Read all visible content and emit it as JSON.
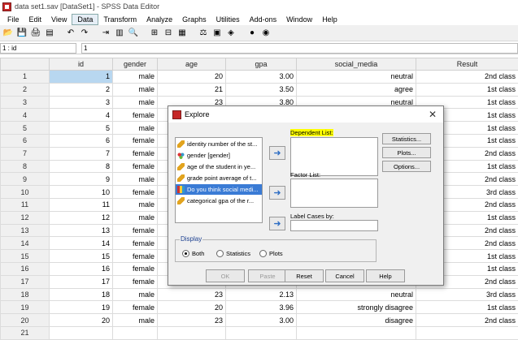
{
  "window": {
    "title": "data set1.sav [DataSet1] - SPSS Data Editor"
  },
  "menu": [
    "File",
    "Edit",
    "View",
    "Data",
    "Transform",
    "Analyze",
    "Graphs",
    "Utilities",
    "Add-ons",
    "Window",
    "Help"
  ],
  "menu_active": "Data",
  "toolbar_icons": [
    "open-icon",
    "save-icon",
    "print-icon",
    "dialog-recall-icon",
    "undo-icon",
    "redo-icon",
    "goto-case-icon",
    "variables-icon",
    "find-icon",
    "insert-cases-icon",
    "insert-variable-icon",
    "split-file-icon",
    "weight-cases-icon",
    "select-cases-icon",
    "value-labels-icon",
    "use-sets-icon",
    "show-sets-icon"
  ],
  "refbar": {
    "cell_ref": "1 : id",
    "cell_value": "1"
  },
  "grid": {
    "columns": [
      "id",
      "gender",
      "age",
      "gpa",
      "social_media",
      "Result"
    ],
    "rows": [
      {
        "n": "1",
        "id": "1",
        "gender": "male",
        "age": "20",
        "gpa": "3.00",
        "social_media": "neutral",
        "result": "2nd class"
      },
      {
        "n": "2",
        "id": "2",
        "gender": "male",
        "age": "21",
        "gpa": "3.50",
        "social_media": "agree",
        "result": "1st class"
      },
      {
        "n": "3",
        "id": "3",
        "gender": "male",
        "age": "23",
        "gpa": "3.80",
        "social_media": "neutral",
        "result": "1st class"
      },
      {
        "n": "4",
        "id": "4",
        "gender": "female",
        "age": "",
        "gpa": "",
        "social_media": "",
        "result": "1st class"
      },
      {
        "n": "5",
        "id": "5",
        "gender": "male",
        "age": "",
        "gpa": "",
        "social_media": "",
        "result": "1st class"
      },
      {
        "n": "6",
        "id": "6",
        "gender": "female",
        "age": "",
        "gpa": "",
        "social_media": "",
        "result": "1st class"
      },
      {
        "n": "7",
        "id": "7",
        "gender": "female",
        "age": "",
        "gpa": "",
        "social_media": "",
        "result": "2nd class"
      },
      {
        "n": "8",
        "id": "8",
        "gender": "female",
        "age": "",
        "gpa": "",
        "social_media": "",
        "result": "1st class"
      },
      {
        "n": "9",
        "id": "9",
        "gender": "male",
        "age": "",
        "gpa": "",
        "social_media": "",
        "result": "2nd class"
      },
      {
        "n": "10",
        "id": "10",
        "gender": "female",
        "age": "",
        "gpa": "",
        "social_media": "",
        "result": "3rd class"
      },
      {
        "n": "11",
        "id": "11",
        "gender": "male",
        "age": "",
        "gpa": "",
        "social_media": "",
        "result": "2nd class"
      },
      {
        "n": "12",
        "id": "12",
        "gender": "male",
        "age": "",
        "gpa": "",
        "social_media": "",
        "result": "1st class"
      },
      {
        "n": "13",
        "id": "13",
        "gender": "female",
        "age": "",
        "gpa": "",
        "social_media": "",
        "result": "2nd class"
      },
      {
        "n": "14",
        "id": "14",
        "gender": "female",
        "age": "",
        "gpa": "",
        "social_media": "",
        "result": "2nd class"
      },
      {
        "n": "15",
        "id": "15",
        "gender": "female",
        "age": "",
        "gpa": "",
        "social_media": "",
        "result": "1st class"
      },
      {
        "n": "16",
        "id": "16",
        "gender": "female",
        "age": "",
        "gpa": "",
        "social_media": "",
        "result": "1st class"
      },
      {
        "n": "17",
        "id": "17",
        "gender": "female",
        "age": "",
        "gpa": "",
        "social_media": "",
        "result": "2nd class"
      },
      {
        "n": "18",
        "id": "18",
        "gender": "male",
        "age": "23",
        "gpa": "2.13",
        "social_media": "neutral",
        "result": "3rd class"
      },
      {
        "n": "19",
        "id": "19",
        "gender": "female",
        "age": "20",
        "gpa": "3.96",
        "social_media": "strongly disagree",
        "result": "1st class"
      },
      {
        "n": "20",
        "id": "20",
        "gender": "male",
        "age": "23",
        "gpa": "3.00",
        "social_media": "disagree",
        "result": "2nd class"
      },
      {
        "n": "21",
        "id": "",
        "gender": "",
        "age": "",
        "gpa": "",
        "social_media": "",
        "result": ""
      }
    ]
  },
  "dialog": {
    "title": "Explore",
    "variables": [
      {
        "label": "identity number of the st...",
        "icon": "scale-icon"
      },
      {
        "label": "gender [gender]",
        "icon": "nominal-icon"
      },
      {
        "label": "age of the student in ye...",
        "icon": "scale-icon"
      },
      {
        "label": "grade point average of t...",
        "icon": "scale-icon"
      },
      {
        "label": "Do you think social medi...",
        "icon": "ordinal-icon"
      },
      {
        "label": "categorical gpa of the r...",
        "icon": "scale-icon"
      }
    ],
    "dependent_label": "Dependent List:",
    "factor_label": "Factor List:",
    "label_cases_label": "Label Cases by:",
    "side_buttons": [
      "Statistics...",
      "Plots...",
      "Options..."
    ],
    "display": {
      "legend": "Display",
      "options": [
        "Both",
        "Statistics",
        "Plots"
      ],
      "selected": "Both"
    },
    "bottom_buttons": [
      "OK",
      "Paste",
      "Reset",
      "Cancel",
      "Help"
    ],
    "disabled_buttons": [
      "OK",
      "Paste"
    ]
  }
}
